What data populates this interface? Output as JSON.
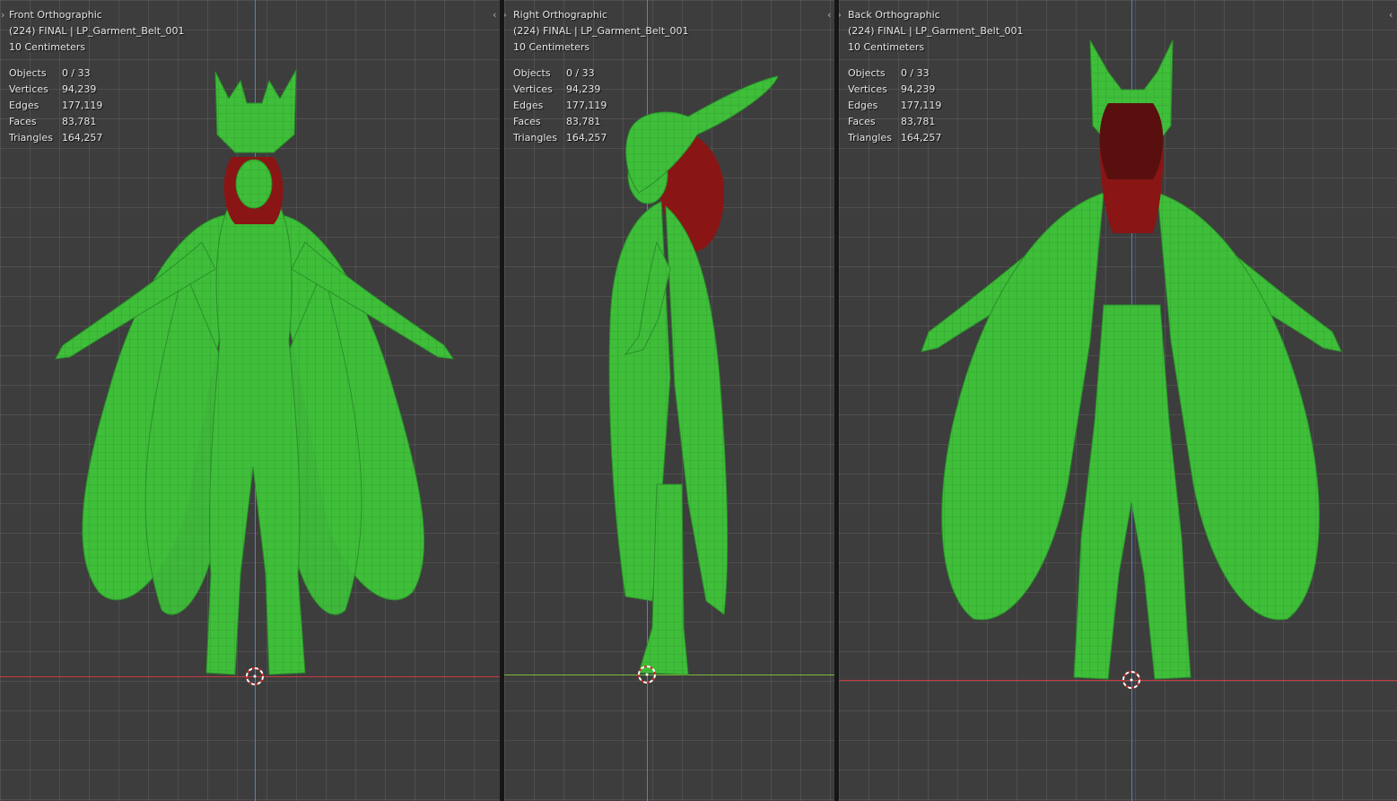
{
  "viewports": {
    "front": {
      "view_name": "Front Orthographic",
      "object_line": "(224) FINAL | LP_Garment_Belt_001",
      "scale": "10 Centimeters",
      "stats": [
        {
          "label": "Objects",
          "value": "0 / 33"
        },
        {
          "label": "Vertices",
          "value": "94,239"
        },
        {
          "label": "Edges",
          "value": "177,119"
        },
        {
          "label": "Faces",
          "value": "83,781"
        },
        {
          "label": "Triangles",
          "value": "164,257"
        }
      ]
    },
    "right": {
      "view_name": "Right Orthographic",
      "object_line": "(224) FINAL | LP_Garment_Belt_001",
      "scale": "10 Centimeters",
      "stats": [
        {
          "label": "Objects",
          "value": "0 / 33"
        },
        {
          "label": "Vertices",
          "value": "94,239"
        },
        {
          "label": "Edges",
          "value": "177,119"
        },
        {
          "label": "Faces",
          "value": "83,781"
        },
        {
          "label": "Triangles",
          "value": "164,257"
        }
      ]
    },
    "back": {
      "view_name": "Back Orthographic",
      "object_line": "(224) FINAL | LP_Garment_Belt_001",
      "scale": "10 Centimeters",
      "stats": [
        {
          "label": "Objects",
          "value": "0 / 33"
        },
        {
          "label": "Vertices",
          "value": "94,239"
        },
        {
          "label": "Edges",
          "value": "177,119"
        },
        {
          "label": "Faces",
          "value": "83,781"
        },
        {
          "label": "Triangles",
          "value": "164,257"
        }
      ]
    }
  },
  "icons": {
    "region_toggle": "chevron-icon",
    "cursor": "3d-cursor-icon"
  },
  "colors": {
    "viewport_bg": "#3d3d3d",
    "grid_line": "#4a4a4a",
    "mesh_green": "#3fbe3a",
    "mesh_green_dark": "#2a8f2a",
    "hair": "#8a1515",
    "axis_x": "#c8393f",
    "axis_y": "#7fb83a",
    "axis_z": "#5a7ec8"
  }
}
